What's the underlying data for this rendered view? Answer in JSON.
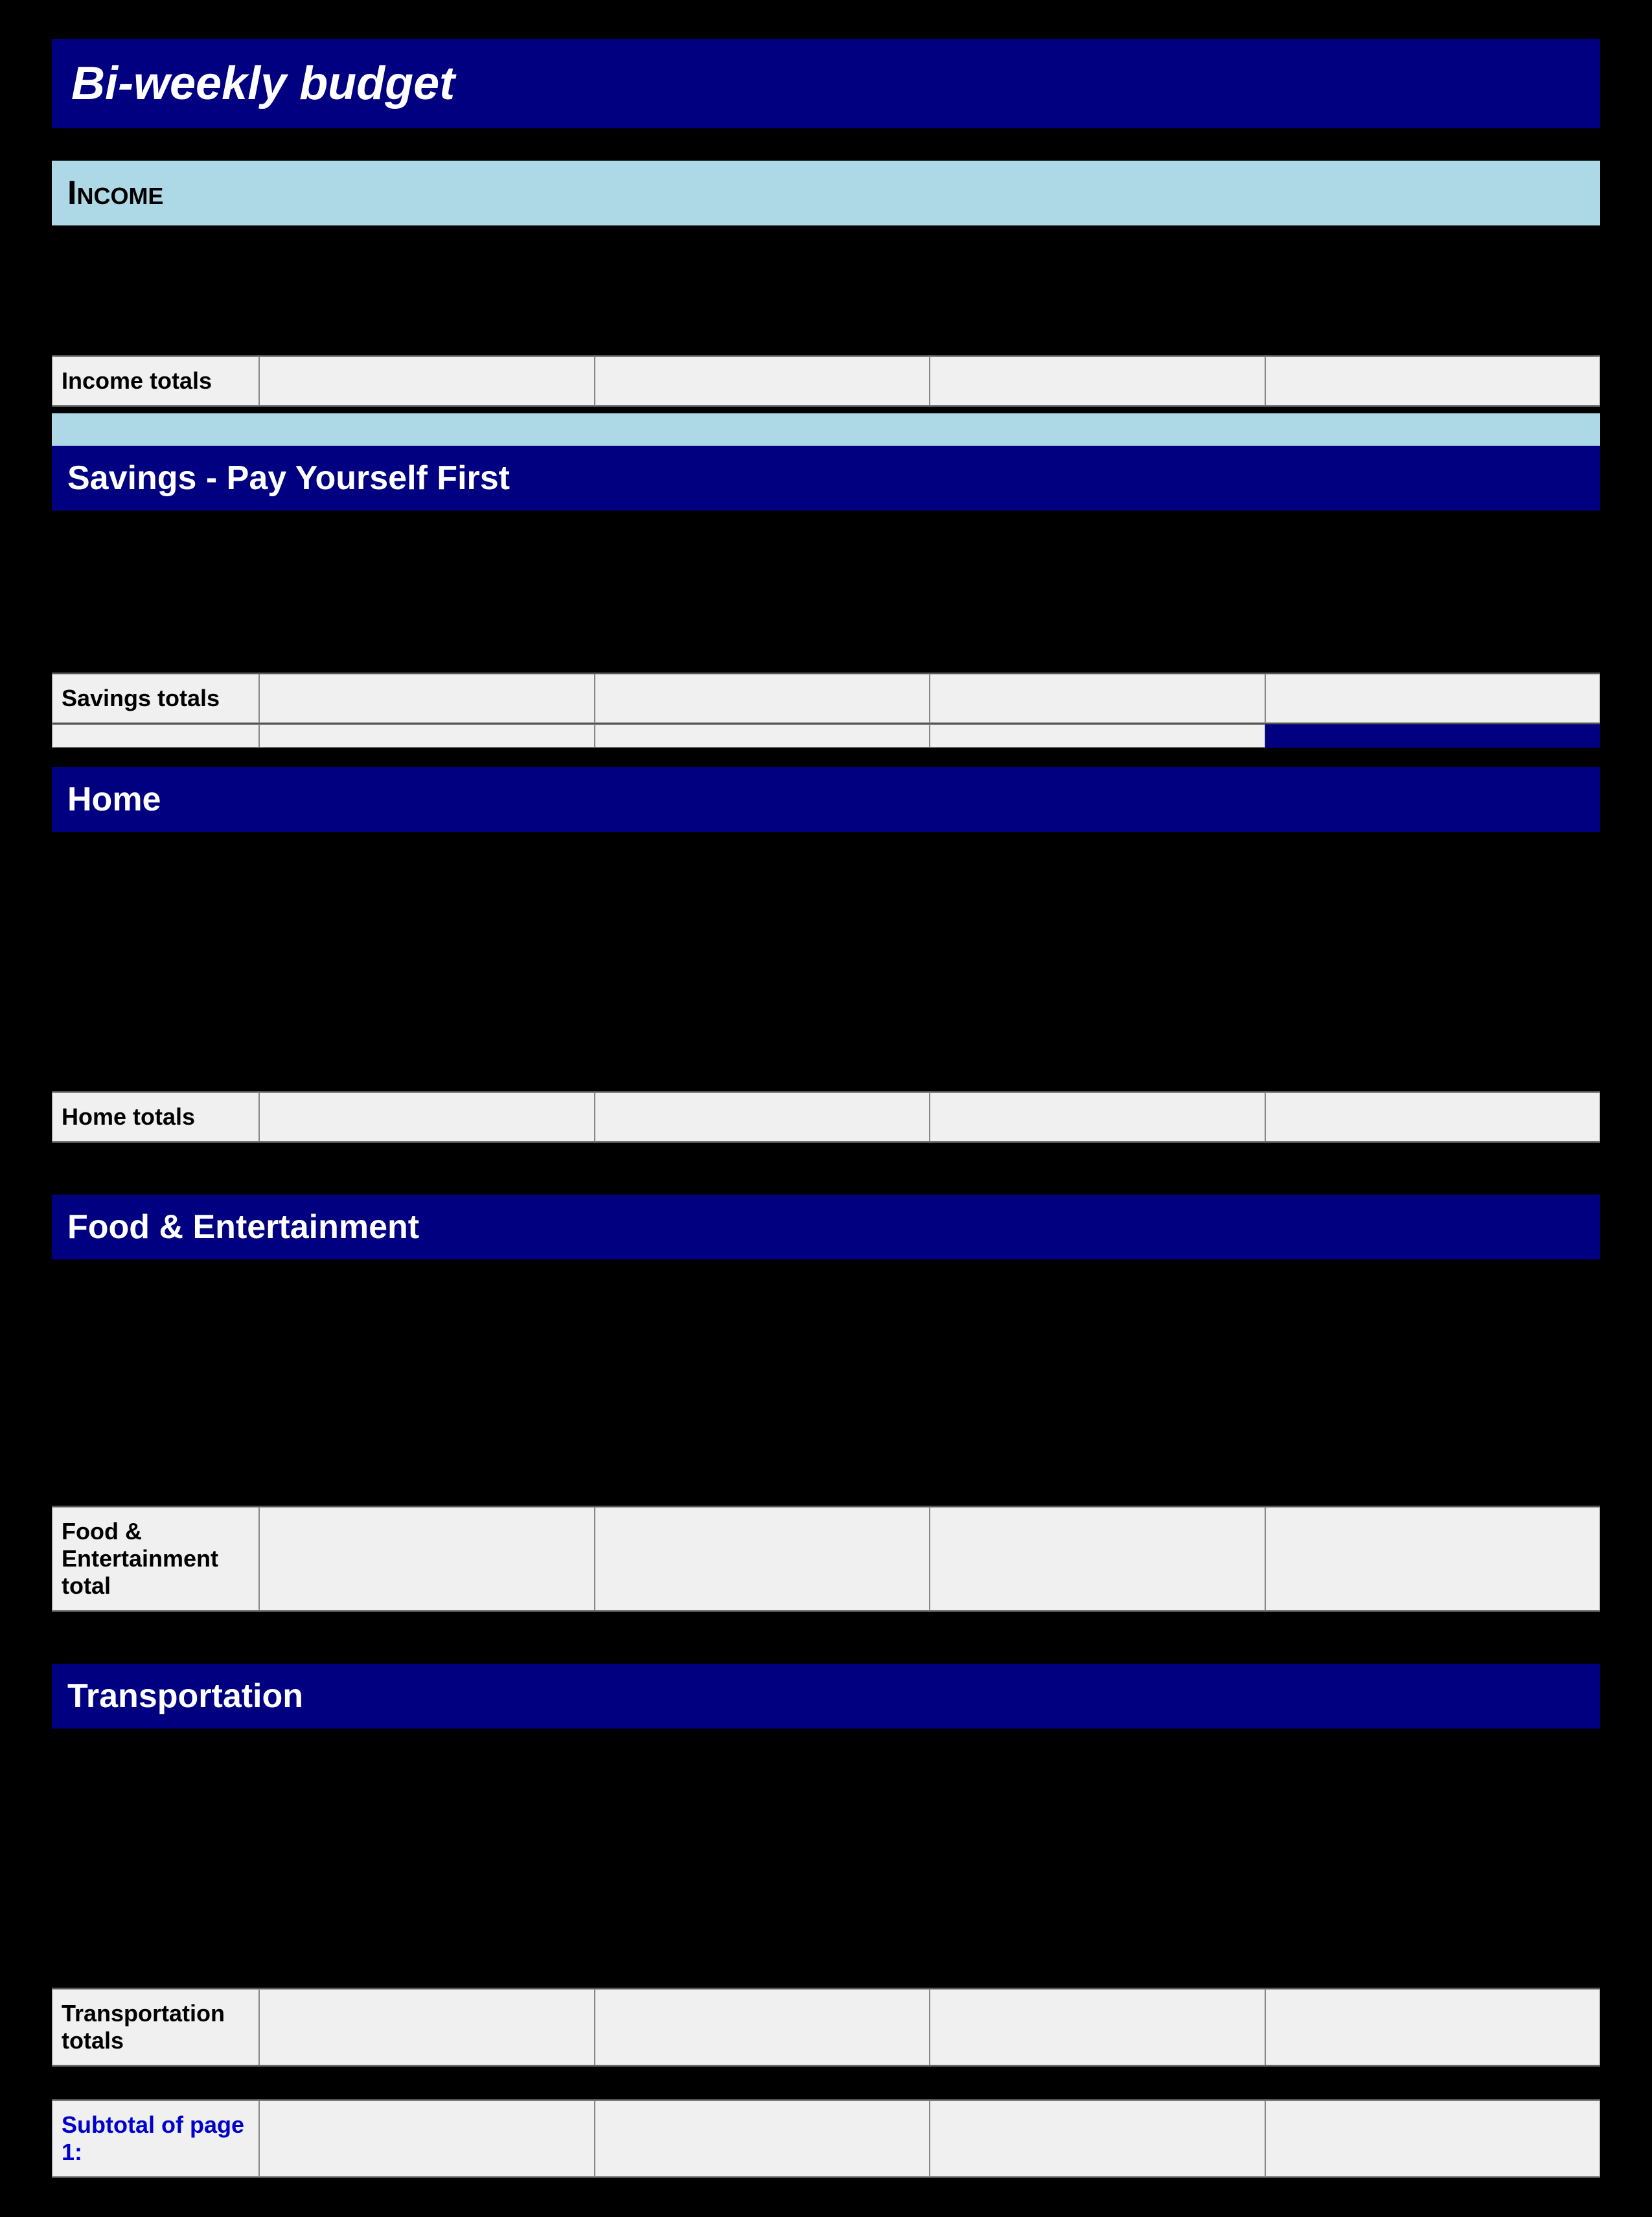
{
  "page": {
    "title": "Bi-weekly  budget"
  },
  "sections": {
    "income": {
      "title": "Income",
      "totals_label": "Income totals",
      "cells": [
        "",
        "",
        "",
        ""
      ]
    },
    "savings": {
      "title": "Savings - Pay Yourself First",
      "totals_label": "Savings totals",
      "cells": [
        "",
        "",
        "",
        ""
      ]
    },
    "home": {
      "title": "Home",
      "totals_label": "Home totals",
      "cells": [
        "",
        "",
        "",
        ""
      ]
    },
    "food": {
      "title": "Food & Entertainment",
      "totals_label": "Food & Entertainment total",
      "cells": [
        "",
        "",
        "",
        ""
      ]
    },
    "transportation": {
      "title": "Transportation",
      "totals_label": "Transportation totals",
      "cells": [
        "",
        "",
        "",
        ""
      ]
    },
    "subtotal": {
      "label": "Subtotal of page 1:",
      "cells": [
        "",
        "",
        "",
        ""
      ]
    }
  }
}
